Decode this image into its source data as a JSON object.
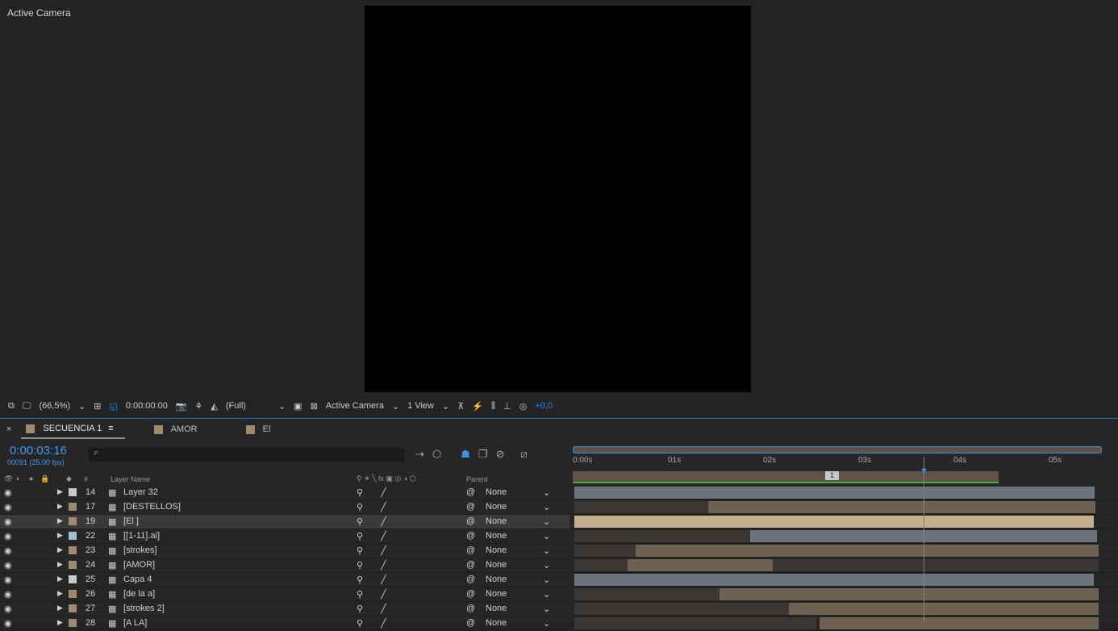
{
  "viewer": {
    "label": "Active Camera"
  },
  "toolbar": {
    "zoom": "(66,5%)",
    "timecode": "0:00:00:00",
    "resolution": "(Full)",
    "camera": "Active Camera",
    "views": "1 View",
    "exposure": "+0,0"
  },
  "tabs": [
    {
      "label": "SECUENCIA 1",
      "color": "#a08a6a"
    },
    {
      "label": "AMOR",
      "color": "#a08a6a"
    },
    {
      "label": "El",
      "color": "#a08a6a"
    }
  ],
  "timeline": {
    "timecode": "0:00:03:16",
    "frames": "00091 (25.00 fps)",
    "search_placeholder": "",
    "col_layer_name": "Layer Name",
    "col_parent": "Parent",
    "col_num": "#",
    "ruler": [
      "0:00s",
      "01s",
      "02s",
      "03s",
      "04s",
      "05s"
    ],
    "marker": "1"
  },
  "layers": [
    {
      "num": "14",
      "name": "Layer 32",
      "color": "#c9c9c9",
      "parent": "None"
    },
    {
      "num": "17",
      "name": "[DESTELLOS]",
      "color": "#a08a6a",
      "parent": "None"
    },
    {
      "num": "19",
      "name": "[El ]",
      "color": "#a08a6a",
      "parent": "None"
    },
    {
      "num": "22",
      "name": "[[1-11].ai]",
      "color": "#9fc3d4",
      "parent": "None"
    },
    {
      "num": "23",
      "name": "[strokes]",
      "color": "#a08a6a",
      "parent": "None"
    },
    {
      "num": "24",
      "name": "[AMOR]",
      "color": "#a08a6a",
      "parent": "None"
    },
    {
      "num": "25",
      "name": "Capa 4",
      "color": "#c9c9c9",
      "parent": "None"
    },
    {
      "num": "26",
      "name": "[de la a]",
      "color": "#a08a6a",
      "parent": "None"
    },
    {
      "num": "27",
      "name": "[strokes 2]",
      "color": "#a08a6a",
      "parent": "None"
    },
    {
      "num": "28",
      "name": "[A LA]",
      "color": "#a08a6a",
      "parent": "None"
    }
  ]
}
